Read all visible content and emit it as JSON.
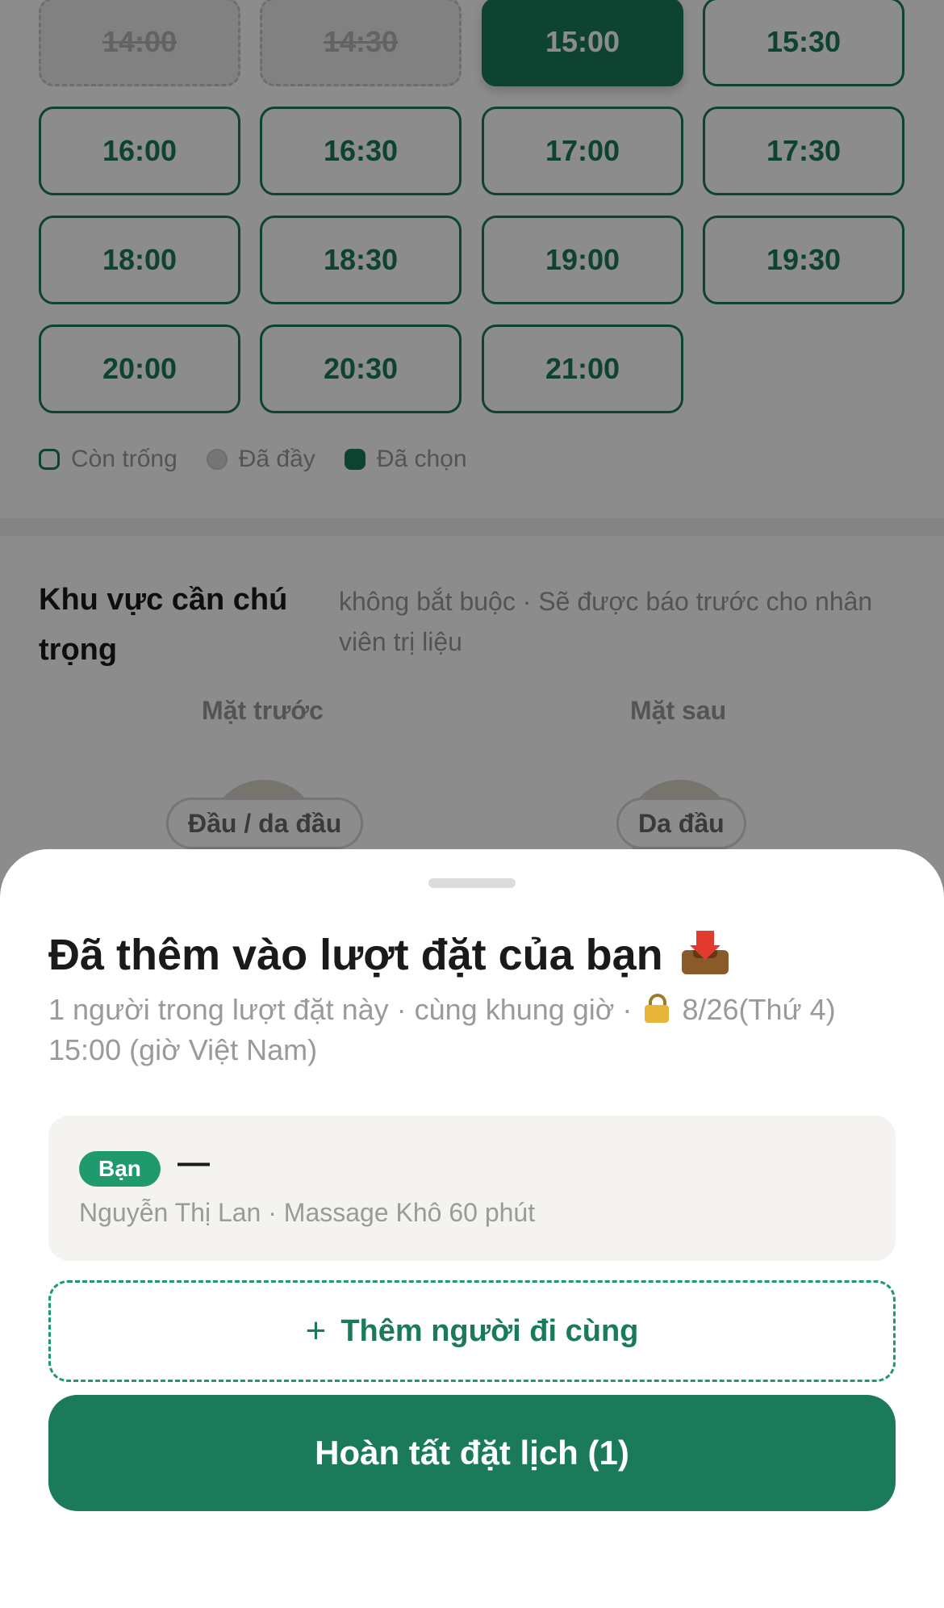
{
  "time_slots": [
    {
      "label": "14:00",
      "state": "full"
    },
    {
      "label": "14:30",
      "state": "full"
    },
    {
      "label": "15:00",
      "state": "selected"
    },
    {
      "label": "15:30",
      "state": "open"
    },
    {
      "label": "16:00",
      "state": "open"
    },
    {
      "label": "16:30",
      "state": "open"
    },
    {
      "label": "17:00",
      "state": "open"
    },
    {
      "label": "17:30",
      "state": "open"
    },
    {
      "label": "18:00",
      "state": "open"
    },
    {
      "label": "18:30",
      "state": "open"
    },
    {
      "label": "19:00",
      "state": "open"
    },
    {
      "label": "19:30",
      "state": "open"
    },
    {
      "label": "20:00",
      "state": "open"
    },
    {
      "label": "20:30",
      "state": "open"
    },
    {
      "label": "21:00",
      "state": "open"
    }
  ],
  "legend": {
    "available": "Còn trống",
    "full": "Đã đầy",
    "selected": "Đã chọn"
  },
  "focus_area": {
    "title": "Khu vực cần chú trọng",
    "description": "không bắt buộc · Sẽ được báo trước cho nhân viên trị liệu",
    "front_label": "Mặt trước",
    "back_label": "Mặt sau",
    "front_region": "Đầu / da đầu",
    "back_region": "Da đầu"
  },
  "sheet": {
    "title": "Đã thêm vào lượt đặt của bạn",
    "title_icon": "inbox-tray-icon",
    "subtitle_before_lock": "1 người trong lượt đặt này · cùng khung giờ ·",
    "subtitle_after_lock": "8/26(Thứ 4) 15:00 (giờ Việt Nam)",
    "member": {
      "badge": "Bạn",
      "name_placeholder": "—",
      "detail": "Nguyễn Thị Lan · Massage Khô 60 phút"
    },
    "add_companion_plus": "+",
    "add_companion_label": "Thêm người đi cùng",
    "confirm_label": "Hoàn tất đặt lịch (1)"
  },
  "colors": {
    "accent": "#1a7a5a",
    "badge": "#1f9a6e"
  }
}
